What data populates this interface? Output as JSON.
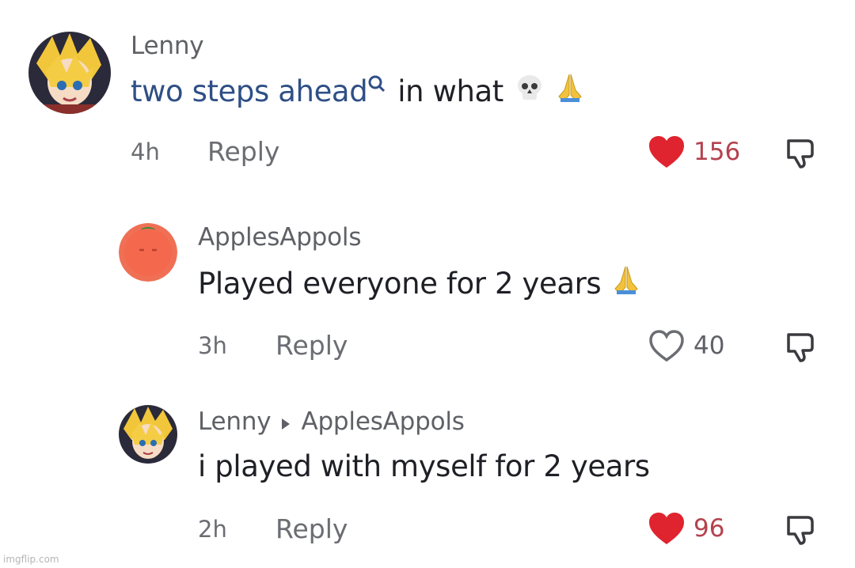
{
  "comments": [
    {
      "author": "Lenny",
      "text_link": "two steps ahead",
      "text_rest": "in what",
      "emojis": [
        "skull-emoji",
        "praying-hands-emoji"
      ],
      "time": "4h",
      "reply_label": "Reply",
      "likes": "156",
      "liked": true
    },
    {
      "author": "ApplesAppols",
      "text": "Played everyone for 2 years",
      "emojis": [
        "praying-hands-emoji"
      ],
      "time": "3h",
      "reply_label": "Reply",
      "likes": "40",
      "liked": false
    },
    {
      "author": "Lenny",
      "reply_to": "ApplesAppols",
      "text": "i played with myself for 2 years",
      "time": "2h",
      "reply_label": "Reply",
      "likes": "96",
      "liked": true
    }
  ],
  "watermark": "imgflip.com",
  "colors": {
    "like_red": "#e0242f",
    "link_blue": "#2f4f86",
    "muted_text": "#6b6d72"
  }
}
